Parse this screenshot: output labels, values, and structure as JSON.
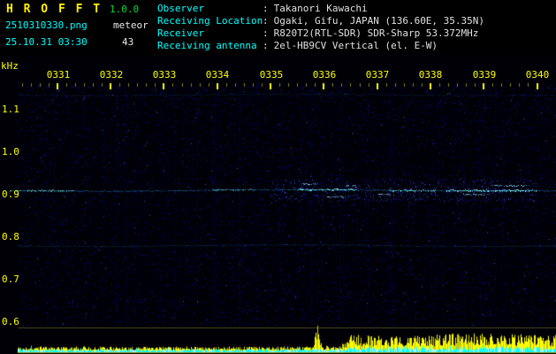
{
  "header": {
    "title": "H R O F F T",
    "version": "1.0.0",
    "filename": "2510310330.png",
    "mode": "meteor",
    "datetime": "25.10.31 03:30",
    "count": "43"
  },
  "info": {
    "separator": ":",
    "rows": [
      {
        "label": "Observer",
        "value": "Takanori Kawachi"
      },
      {
        "label": "Receiving Location",
        "value": "Ogaki, Gifu, JAPAN (136.60E, 35.35N)"
      },
      {
        "label": "Receiver",
        "value": "R820T2(RTL-SDR) SDR-Sharp 53.372MHz"
      },
      {
        "label": "Receiving antenna",
        "value": "2el-HB9CV Vertical (el. E-W)"
      }
    ]
  },
  "chart_data": {
    "type": "heatmap",
    "x_ticks": [
      "0331",
      "0332",
      "0333",
      "0334",
      "0335",
      "0336",
      "0337",
      "0338",
      "0339",
      "0340"
    ],
    "x_range_min": [
      0,
      10
    ],
    "y_label": "kHz",
    "y_ticks": [
      "1.1",
      "1.0",
      "0.9",
      "0.8",
      "0.7",
      "0.6"
    ],
    "y_range_khz": [
      0.58,
      1.16
    ],
    "signal_lines": [
      {
        "name": "direct-carrier",
        "freq_khz": 0.91,
        "base_intensity": 0.5,
        "bright_segments": [
          {
            "from_min": 0.1,
            "to_min": 1.3,
            "intensity": 0.7
          },
          {
            "from_min": 3.9,
            "to_min": 4.7,
            "intensity": 0.55
          },
          {
            "from_min": 5.5,
            "to_min": 6.6,
            "intensity": 0.95
          },
          {
            "from_min": 7.2,
            "to_min": 8.1,
            "intensity": 0.8
          },
          {
            "from_min": 8.3,
            "to_min": 10,
            "intensity": 1.0
          }
        ]
      },
      {
        "name": "faint-line-mid",
        "freq_khz": 0.78,
        "base_intensity": 0.22,
        "bright_segments": []
      },
      {
        "name": "faint-line-top",
        "freq_khz": 1.135,
        "base_intensity": 0.14,
        "bright_segments": []
      }
    ],
    "echo_marks": [
      {
        "t_min": 5.6,
        "freq_khz": 0.925,
        "len_min": 0.25
      },
      {
        "t_min": 6.05,
        "freq_khz": 0.895,
        "len_min": 0.35
      },
      {
        "t_min": 6.4,
        "freq_khz": 0.92,
        "len_min": 0.2
      },
      {
        "t_min": 7.0,
        "freq_khz": 0.9,
        "len_min": 0.3
      },
      {
        "t_min": 8.6,
        "freq_khz": 0.9,
        "len_min": 0.5
      },
      {
        "t_min": 9.1,
        "freq_khz": 0.921,
        "len_min": 0.7
      }
    ],
    "level_meter": {
      "envelope": [
        {
          "t_min": 0,
          "v": 0.18
        },
        {
          "t_min": 5.78,
          "v": 0.18
        },
        {
          "t_min": 5.87,
          "v": 1.0
        },
        {
          "t_min": 5.96,
          "v": 0.2
        },
        {
          "t_min": 6.3,
          "v": 0.22
        },
        {
          "t_min": 6.5,
          "v": 0.55
        },
        {
          "t_min": 7.6,
          "v": 0.5
        },
        {
          "t_min": 8.6,
          "v": 0.62
        },
        {
          "t_min": 10,
          "v": 0.55
        }
      ],
      "cyan_base": 0.1
    },
    "colors": {
      "axis_tick": "#ffff00",
      "signal": "#00ffff",
      "noise_blue": "#0d0d85",
      "meter_yellow": "#ffff00",
      "meter_cyan": "#00ffff",
      "background": "#000006"
    }
  }
}
